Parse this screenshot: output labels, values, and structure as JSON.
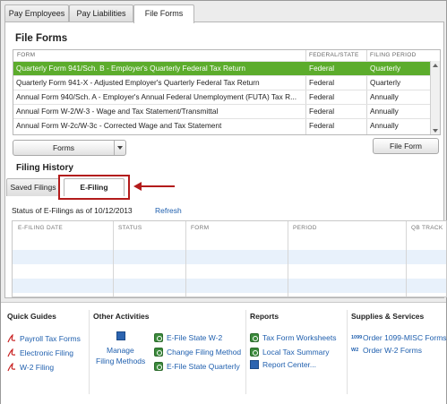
{
  "tabs": [
    "Pay Employees",
    "Pay Liabilities",
    "File Forms"
  ],
  "file_forms": {
    "title": "File Forms",
    "columns": [
      "FORM",
      "FEDERAL/STATE",
      "FILING PERIOD"
    ],
    "rows": [
      {
        "form": "Quarterly Form 941/Sch. B - Employer's Quarterly Federal Tax Return",
        "fed_state": "Federal",
        "period": "Quarterly"
      },
      {
        "form": "Quarterly Form 941-X - Adjusted Employer's Quarterly Federal Tax Return",
        "fed_state": "Federal",
        "period": "Quarterly"
      },
      {
        "form": "Annual Form 940/Sch. A - Employer's Annual Federal Unemployment (FUTA) Tax R...",
        "fed_state": "Federal",
        "period": "Annually"
      },
      {
        "form": "Annual Form W-2/W-3 - Wage and Tax Statement/Transmittal",
        "fed_state": "Federal",
        "period": "Annually"
      },
      {
        "form": "Annual Form W-2c/W-3c - Corrected Wage and Tax Statement",
        "fed_state": "Federal",
        "period": "Annually"
      }
    ],
    "forms_button": "Forms",
    "file_form_button": "File Form"
  },
  "filing_history": {
    "title": "Filing History",
    "tabs": [
      "Saved Filings",
      "E-Filing"
    ],
    "status_text": "Status of E-Filings as of 10/12/2013",
    "refresh": "Refresh",
    "columns": [
      "E-FILING DATE",
      "STATUS",
      "FORM",
      "PERIOD",
      "QB TRACK"
    ]
  },
  "bottom": {
    "quick_guides": {
      "title": "Quick Guides",
      "items": [
        "Payroll Tax Forms",
        "Electronic Filing",
        "W-2 Filing"
      ]
    },
    "other_activities": {
      "title": "Other Activities",
      "manage_line1": "Manage",
      "manage_line2": "Filing Methods",
      "items": [
        "E-File State W-2",
        "Change Filing Method",
        "E-File State Quarterly"
      ]
    },
    "reports": {
      "title": "Reports",
      "items": [
        "Tax Form Worksheets",
        "Local Tax Summary",
        "Report Center..."
      ]
    },
    "supplies": {
      "title": "Supplies & Services",
      "badge1": "1099",
      "badge2": "W2",
      "items": [
        "Order 1099-MISC Forms",
        "Order W-2 Forms"
      ]
    }
  },
  "colors": {
    "selected_row": "#5cac2c",
    "link": "#1f5fae",
    "highlight": "#b31b1b"
  }
}
